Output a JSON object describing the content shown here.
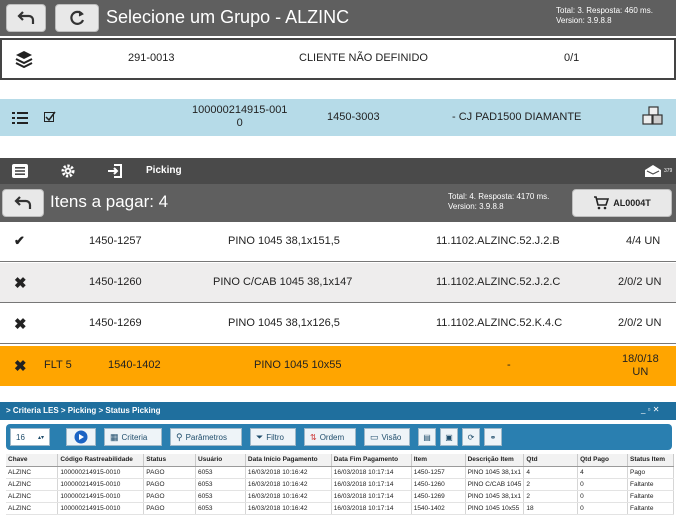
{
  "header": {
    "title": "Selecione um Grupo - ALZINC",
    "info_line1": "Total: 3. Resposta: 460 ms.",
    "info_line2": "Version: 3.9.8.8"
  },
  "group_row": {
    "code": "291-0013",
    "client": "CLIENTE NÃO DEFINIDO",
    "count": "0/1"
  },
  "op_row": {
    "id_line1": "100000214915-001",
    "id_line2": "0",
    "code": "1450-3003",
    "desc": "- CJ PAD1500 DIAMANTE"
  },
  "toolbar": {
    "label": "Picking",
    "badge": "379"
  },
  "items_header": {
    "title": "Itens a pagar: 4",
    "info_line1": "Total: 4. Resposta: 4170 ms.",
    "info_line2": "Version: 3.9.8.8",
    "cart_label": "AL0004T"
  },
  "items": [
    {
      "flt": "",
      "code": "1450-1257",
      "desc": "PINO 1045 38,1x151,5",
      "loc": "11.1102.ALZINC.52.J.2.B",
      "qty": "4/4 UN"
    },
    {
      "flt": "",
      "code": "1450-1260",
      "desc": "PINO C/CAB 1045 38,1x147",
      "loc": "11.1102.ALZINC.52.J.2.C",
      "qty": "2/0/2 UN"
    },
    {
      "flt": "",
      "code": "1450-1269",
      "desc": "PINO 1045 38,1x126,5",
      "loc": "11.1102.ALZINC.52.K.4.C",
      "qty": "2/0/2 UN"
    },
    {
      "flt": "FLT 5",
      "code": "1540-1402",
      "desc": "PINO 1045 10x55",
      "loc": "-",
      "qty_line1": "18/0/18",
      "qty_line2": "UN"
    }
  ],
  "panel": {
    "breadcrumb": "> Criteria LES > Picking > Status Picking",
    "page_size": "16",
    "buttons": [
      "Criteria",
      "Parâmetros",
      "Filtro",
      "Ordem",
      "Visão"
    ],
    "columns": [
      "Chave",
      "Código Rastreabilidade",
      "Status",
      "Usuário",
      "Data Início Pagamento",
      "Data Fim Pagamento",
      "Item",
      "Descrição Item",
      "Qtd",
      "Qtd Pago",
      "Status Item"
    ],
    "rows": [
      [
        "ALZINC",
        "100000214915-0010",
        "PAGO",
        "6053",
        "16/03/2018 10:16:42",
        "16/03/2018 10:17:14",
        "1450-1257",
        "PINO 1045 38,1x1",
        "4",
        "4",
        "Pago"
      ],
      [
        "ALZINC",
        "100000214915-0010",
        "PAGO",
        "6053",
        "16/03/2018 10:16:42",
        "16/03/2018 10:17:14",
        "1450-1260",
        "PINO C/CAB 1045",
        "2",
        "0",
        "Faltante"
      ],
      [
        "ALZINC",
        "100000214915-0010",
        "PAGO",
        "6053",
        "16/03/2018 10:16:42",
        "16/03/2018 10:17:14",
        "1450-1269",
        "PINO 1045 38,1x1",
        "2",
        "0",
        "Faltante"
      ],
      [
        "ALZINC",
        "100000214915-0010",
        "PAGO",
        "6053",
        "16/03/2018 10:16:42",
        "16/03/2018 10:17:14",
        "1540-1402",
        "PINO 1045 10x55",
        "18",
        "0",
        "Faltante"
      ]
    ]
  },
  "colors": {
    "header_bg": "#5f5f5f",
    "ops_bg": "#b6dbe8",
    "highlight_row": "#ffa500",
    "panel_accent": "#1f6f9e"
  }
}
